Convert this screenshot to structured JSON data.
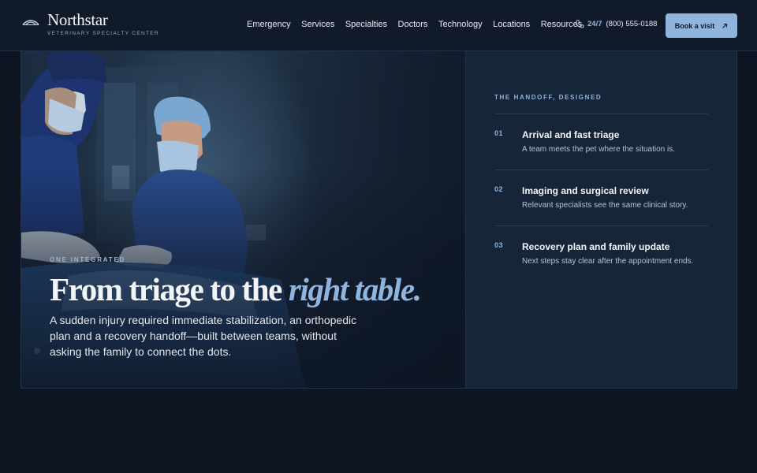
{
  "header": {
    "brand": {
      "name": "Northstar",
      "tagline": "VETERINARY SPECIALTY CENTER",
      "logo_icon": "eye-arc-logo-icon"
    },
    "nav": [
      "Emergency",
      "Services",
      "Specialties",
      "Doctors",
      "Technology",
      "Locations",
      "Resources"
    ],
    "phone": {
      "icon": "phone-icon",
      "availability": "24/7",
      "number": "(800) 555-0188"
    },
    "cta": {
      "label": "Book a visit",
      "icon": "arrow-up-right-icon"
    }
  },
  "hero": {
    "eyebrow": "ONE INTEGRATED",
    "headline": {
      "main": "From triage to the ",
      "emphasis": "right table."
    },
    "body": "A sudden injury required immediate stabilization, an orthopedic plan and a recovery handoff—built between teams, without asking the family to connect the dots.",
    "image": "surgeons-in-operating-room-photo"
  },
  "panel": {
    "eyebrow": "THE HANDOFF, DESIGNED",
    "steps": [
      {
        "num": "01",
        "title": "Arrival and fast triage",
        "desc": "A team meets the pet where the situation is."
      },
      {
        "num": "02",
        "title": "Imaging and surgical review",
        "desc": "Relevant specialists see the same clinical story."
      },
      {
        "num": "03",
        "title": "Recovery plan and family update",
        "desc": "Next steps stay clear after the appointment ends."
      }
    ]
  },
  "colors": {
    "page_bg": "#0d1523",
    "accent": "#8fb4de",
    "panel_bg": "#162638",
    "header_bg": "#111a28"
  }
}
